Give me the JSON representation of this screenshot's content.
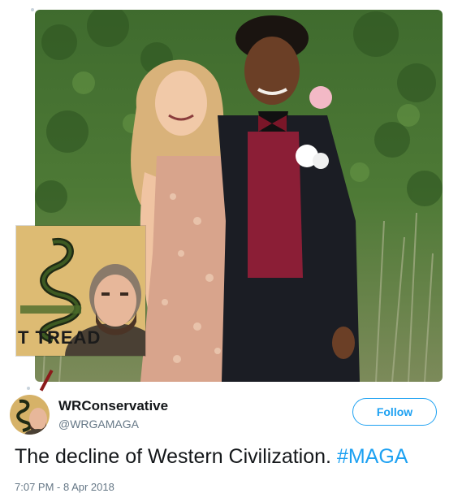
{
  "tweet": {
    "author": {
      "display_name": "WRConservative",
      "handle": "@WRGAMAGA"
    },
    "follow_label": "Follow",
    "text": "The decline of Western Civilization.",
    "hashtag": "#MAGA",
    "timestamp": "7:07 PM - 8 Apr 2018",
    "inset_caption": "T TREAD"
  },
  "colors": {
    "accent": "#1da1f2",
    "secondary_text": "#657786",
    "primary_text": "#14171a"
  },
  "icons": {
    "avatar": "profile-avatar-icon"
  }
}
